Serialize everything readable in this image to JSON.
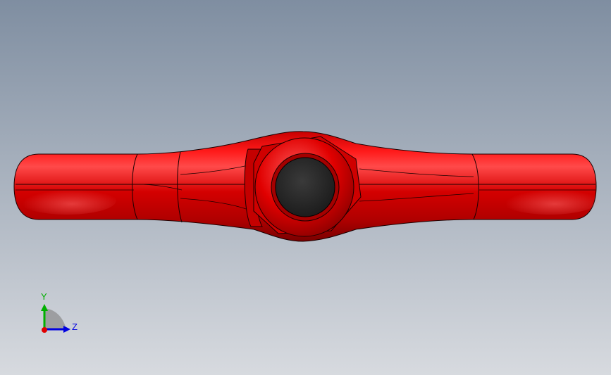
{
  "viewport": {
    "background_top": "#7f8ea1",
    "background_bottom": "#d7dadf"
  },
  "model": {
    "body_color": "#e00000",
    "shadow_color": "#7a0000",
    "highlight_color": "#ff8080",
    "edge_color": "#1a0000",
    "bore_color": "#2c2c2c"
  },
  "triad": {
    "y_label": "Y",
    "z_label": "Z",
    "y_color": "#00b000",
    "z_color": "#0000e0",
    "x_color": "#e00000"
  }
}
